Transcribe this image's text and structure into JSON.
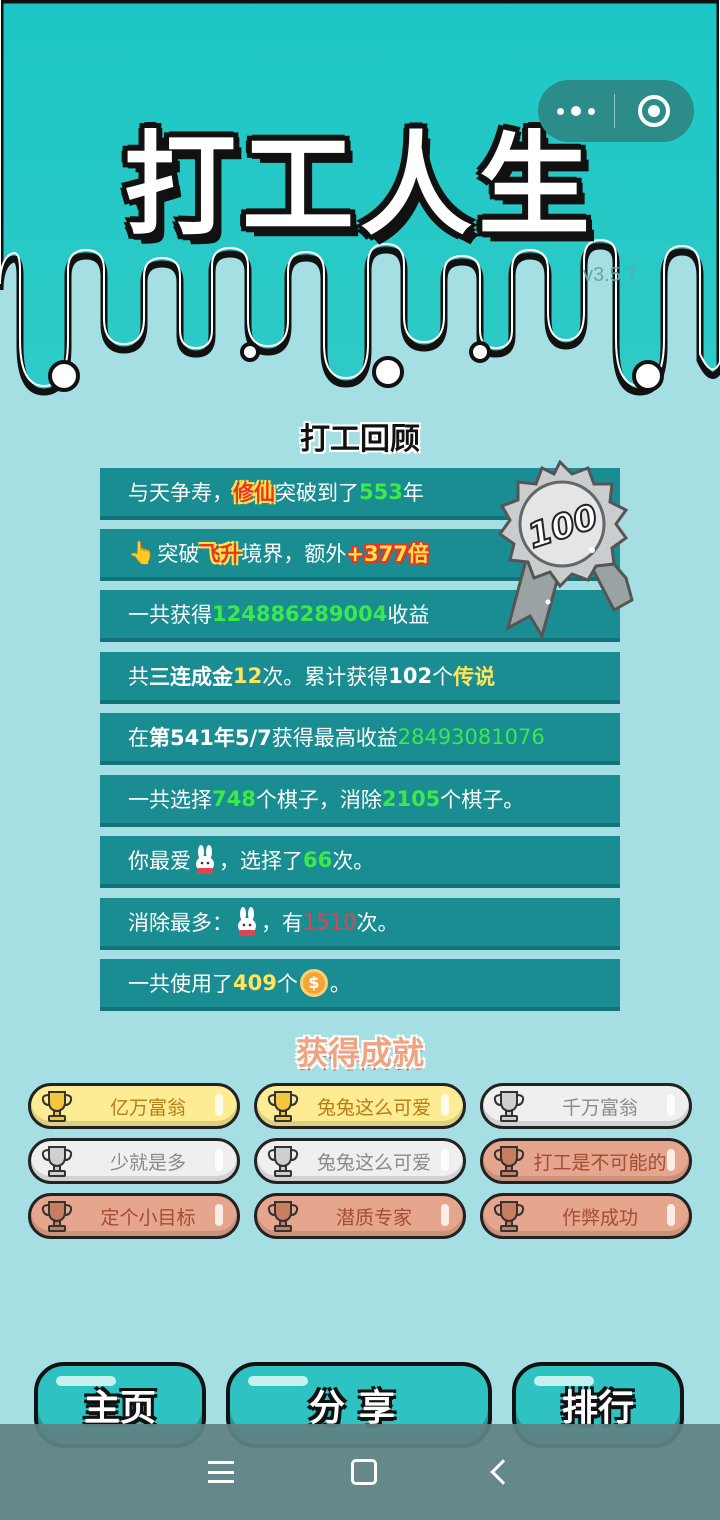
{
  "app": {
    "title": "打工人生",
    "version": "v3.5.7"
  },
  "capsule": {
    "more_icon": "more-dots-icon",
    "close_icon": "target-icon"
  },
  "review": {
    "title": "打工回顾",
    "medal_value": "100",
    "rows": [
      {
        "a": "与天争寿，",
        "b": "修仙",
        "c": "突破到了",
        "d": "553",
        "e": "年"
      },
      {
        "a": "突破",
        "b": "飞升",
        "c": "境界，额外",
        "d": "+377倍"
      },
      {
        "a": "一共获得",
        "b": "124886289004",
        "c": "收益"
      },
      {
        "a": "共",
        "b": "三连成金",
        "c": "12",
        "d": "次。累计获得",
        "e": "102",
        "f": "个",
        "g": "传说"
      },
      {
        "a": "在 ",
        "b": "第541年5/7",
        "c": " 获得最高收益",
        "d": "28493081076"
      },
      {
        "a": "一共选择",
        "b": "748",
        "c": "个棋子，消除",
        "d": "2105",
        "e": "个棋子。"
      },
      {
        "a": "你最爱",
        "b": "，选择了",
        "c": "66",
        "d": "次。"
      },
      {
        "a": "消除最多：",
        "b": "，有",
        "c": "1510",
        "d": "次。"
      },
      {
        "a": "一共使用了",
        "b": "409",
        "c": "个",
        "d": "。"
      }
    ]
  },
  "achievements": {
    "title": "获得成就",
    "items": [
      {
        "label": "亿万富翁",
        "tier": "gold"
      },
      {
        "label": "兔兔这么可爱",
        "tier": "gold"
      },
      {
        "label": "千万富翁",
        "tier": "silver"
      },
      {
        "label": "少就是多",
        "tier": "silver"
      },
      {
        "label": "兔兔这么可爱",
        "tier": "silver"
      },
      {
        "label": "打工是不可能的",
        "tier": "bronze"
      },
      {
        "label": "定个小目标",
        "tier": "bronze"
      },
      {
        "label": "潜质专家",
        "tier": "bronze"
      },
      {
        "label": "作弊成功",
        "tier": "bronze"
      }
    ]
  },
  "buttons": {
    "home": "主页",
    "share": "分享",
    "rank": "排行"
  },
  "colors": {
    "teal": "#2ec3c2",
    "row_bg": "#1a8d93",
    "highlight_green": "#3ce94a",
    "highlight_yellow": "#ffe45c",
    "highlight_red": "#e2434d"
  }
}
